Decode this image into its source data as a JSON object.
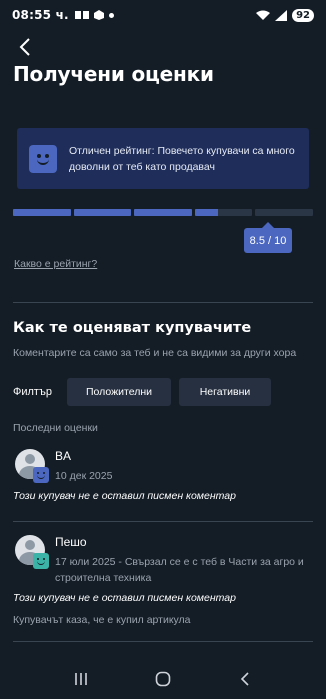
{
  "status_bar": {
    "time": "08:55 ч.",
    "battery": "92"
  },
  "header": {
    "title": "Получени оценки"
  },
  "rating": {
    "message": "Отличен рейтинг: Повечето купувачи са много доволни от теб като продавач",
    "score_label": "8.5 / 10",
    "score": 8.5,
    "max": 10,
    "segment_fills": [
      1,
      1,
      1,
      0.4,
      0
    ],
    "link": "Какво е рейтинг?"
  },
  "buyers_section": {
    "title": "Как те оценяват купувачите",
    "subtitle": "Коментарите са само за теб и не са видими за други хора",
    "filter_label": "Филтър",
    "filter_positive": "Положителни",
    "filter_negative": "Негативни",
    "recent_title": "Последни оценки"
  },
  "reviews": [
    {
      "name": "BA",
      "meta": "10 дек 2025",
      "comment": "Този купувач не е оставил писмен коментар",
      "extra": "",
      "badge_color": "#4b67c0"
    },
    {
      "name": "Пешо",
      "meta": "17 юли 2025 - Свързал се е с теб в Части за агро и строителна техника",
      "comment": "Този купувач не е оставил писмен коментар",
      "extra": "Купувачът каза, че е купил артикула",
      "badge_color": "#3bb3a6"
    }
  ],
  "colors": {
    "background": "#141d26",
    "accent": "#4b67c0",
    "card": "#1e2d5a"
  }
}
